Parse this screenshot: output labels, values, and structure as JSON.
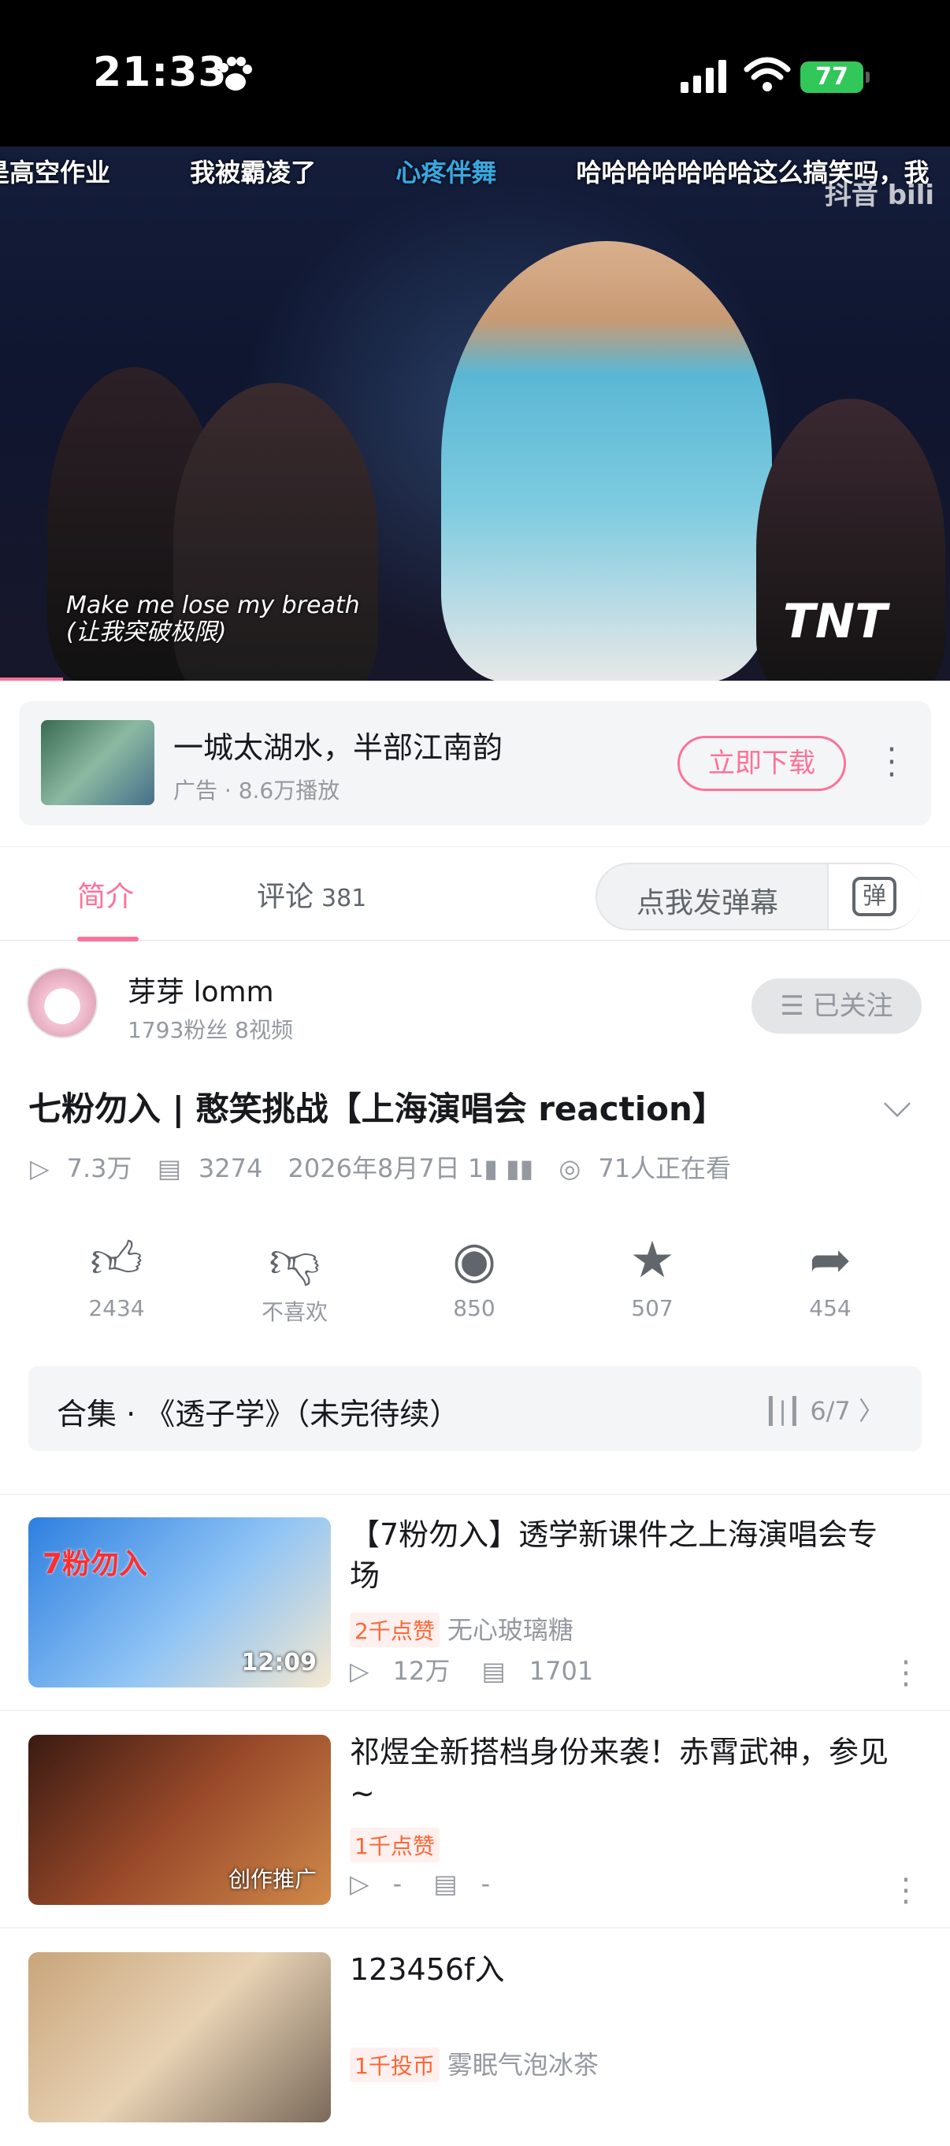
{
  "status_bar": {
    "time": "21:33",
    "battery": "77"
  },
  "player": {
    "danmaku": [
      "是高空作业",
      "我被霸凌了",
      "心疼伴舞",
      "哈哈哈哈哈哈哈这么搞笑吗，我"
    ],
    "watermark": "抖音 bili",
    "subtitle_en": "Make me lose my breath",
    "subtitle_zh": "(让我突破极限)",
    "corner_logo": "TNT"
  },
  "ad": {
    "title": "一城太湖水，半部江南韵",
    "sub": "广告 · 8.6万播放",
    "button": "立即下载"
  },
  "tabs": {
    "intro": "简介",
    "comments": "评论",
    "comments_count": "381",
    "danmaku_input": "点我发弹幕",
    "danmaku_icon": "弹"
  },
  "author": {
    "name": "芽芽 lomm",
    "meta": "1793粉丝  8视频",
    "follow": "☰ 已关注"
  },
  "video": {
    "title": "七粉勿入 | 憨笑挑战【上海演唱会 reaction】",
    "views": "7.3万",
    "danmaku_count": "3274",
    "date": "2026年8月7日 1▮ ▮▮",
    "watching": "71人正在看"
  },
  "actions": [
    {
      "icon": "like-icon",
      "label": "2434"
    },
    {
      "icon": "dislike-icon",
      "label": "不喜欢"
    },
    {
      "icon": "coin-icon",
      "label": "850"
    },
    {
      "icon": "star-icon",
      "label": "507"
    },
    {
      "icon": "share-icon",
      "label": "454"
    }
  ],
  "collection": {
    "title": "合集 · 《透子学》（未完待续）",
    "progress": "6/7"
  },
  "recommendations": [
    {
      "title": "【7粉勿入】透学新课件之上海演唱会专场",
      "badge": "2千点赞",
      "uploader": "无心玻璃糖",
      "views": "12万",
      "danmaku": "1701",
      "duration": "12:09",
      "thumb_text": "7粉勿入"
    },
    {
      "title": "祁煜全新搭档身份来袭！赤霄武神，参见~",
      "badge": "1千点赞",
      "uploader": "",
      "views": "-",
      "danmaku": "-",
      "tag": "创作推广"
    },
    {
      "title": "123456f入",
      "badge": "1千投币",
      "uploader": "雾眠气泡冰茶",
      "views": "",
      "danmaku": ""
    }
  ],
  "colors": {
    "accent": "#fb7299",
    "text": "#18191c",
    "muted": "#9499a0"
  }
}
